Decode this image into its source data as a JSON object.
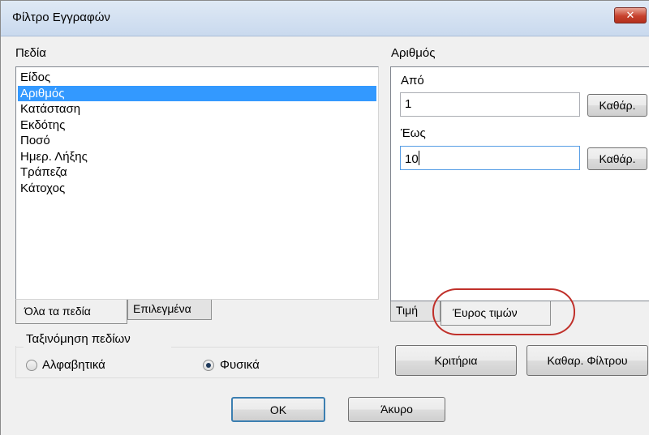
{
  "window": {
    "title": "Φίλτρο Εγγραφών",
    "close_label": "✕"
  },
  "fields": {
    "label": "Πεδία",
    "items": [
      "Είδος",
      "Αριθμός",
      "Κατάσταση",
      "Εκδότης",
      "Ποσό",
      "Ημερ. Λήξης",
      "Τράπεζα",
      "Κάτοχος"
    ],
    "selected": "Αριθμός",
    "tabs": {
      "all": "Όλα τα πεδία",
      "selected": "Επιλεγμένα"
    }
  },
  "sorting": {
    "label": "Ταξινόμηση πεδίων",
    "options": {
      "alphabetical": "Αλφαβητικά",
      "natural": "Φυσικά"
    },
    "checked": "Φυσικά"
  },
  "range": {
    "field_label": "Αριθμός",
    "from_label": "Από",
    "from_value": "1",
    "to_label": "Έως",
    "to_value": "10",
    "clear_label": "Καθάρ."
  },
  "mode_tabs": {
    "value": "Τιμή",
    "range": "Έυρος τιμών"
  },
  "buttons": {
    "criteria": "Κριτήρια",
    "clear_filter": "Καθαρ. Φίλτρου",
    "ok": "OK",
    "cancel": "Άκυρο"
  },
  "colors": {
    "selection": "#3399ff",
    "annotation": "#c0302a",
    "close": "#c7412d"
  }
}
